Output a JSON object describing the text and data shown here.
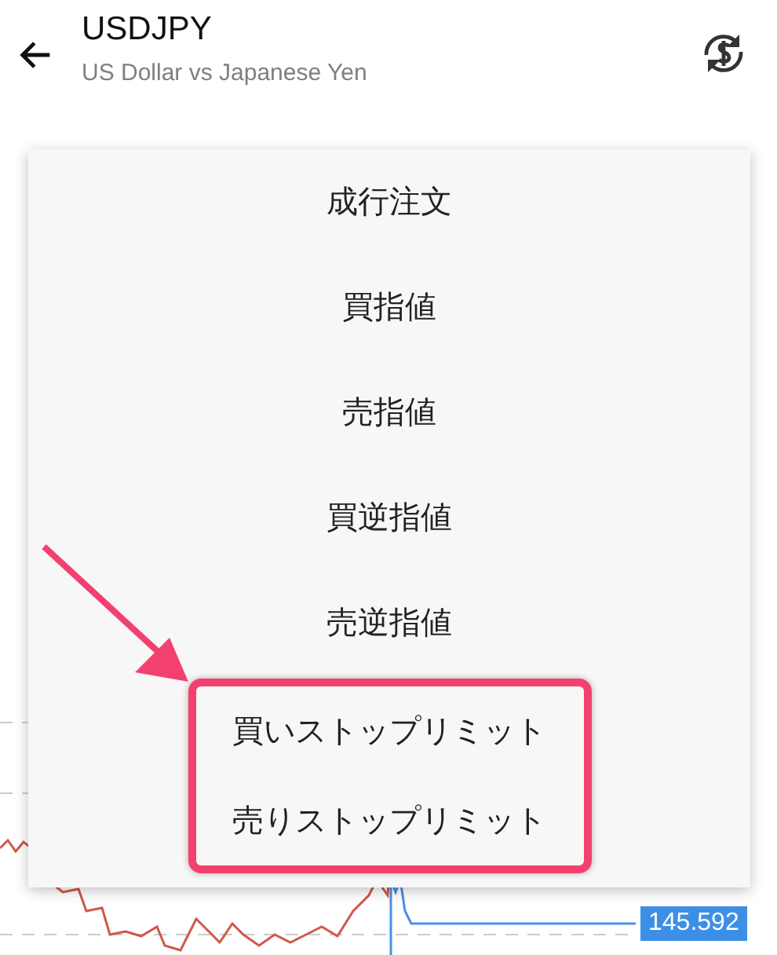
{
  "header": {
    "title": "USDJPY",
    "subtitle": "US Dollar vs Japanese Yen"
  },
  "order_menu": {
    "items": [
      {
        "label": "成行注文",
        "highlighted": false
      },
      {
        "label": "買指値",
        "highlighted": false
      },
      {
        "label": "売指値",
        "highlighted": false
      },
      {
        "label": "買逆指値",
        "highlighted": false
      },
      {
        "label": "売逆指値",
        "highlighted": false
      },
      {
        "label": "買いストップリミット",
        "highlighted": true
      },
      {
        "label": "売りストップリミット",
        "highlighted": true
      }
    ]
  },
  "chart": {
    "price_label": "145.592"
  }
}
